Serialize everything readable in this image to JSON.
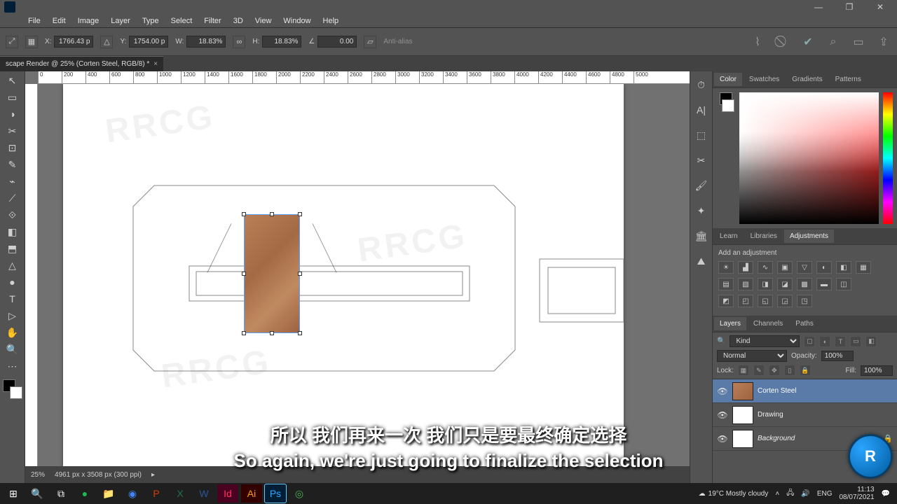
{
  "menu": [
    "File",
    "Edit",
    "Image",
    "Layer",
    "Type",
    "Select",
    "Filter",
    "3D",
    "View",
    "Window",
    "Help"
  ],
  "window_buttons": {
    "min": "—",
    "max": "❐",
    "close": "✕"
  },
  "options": {
    "x_label": "X:",
    "x_val": "1766.43 p",
    "y_label": "Y:",
    "y_val": "1754.00 p",
    "w_label": "W:",
    "w_val": "18.83%",
    "h_label": "H:",
    "h_val": "18.83%",
    "angle_label": "∠",
    "angle_val": "0.00",
    "antialias": "Anti-alias"
  },
  "doc_tab": {
    "title": "scape Render @ 25% (Corten Steel, RGB/8) *"
  },
  "ruler_ticks": [
    "0",
    "200",
    "400",
    "600",
    "800",
    "1000",
    "1200",
    "1400",
    "1600",
    "1800",
    "2000",
    "2200",
    "2400",
    "2600",
    "2800",
    "3000",
    "3200",
    "3400",
    "3600",
    "3800",
    "4000",
    "4200",
    "4400",
    "4600",
    "4800",
    "5000"
  ],
  "status": {
    "zoom": "25%",
    "dims": "4961 px x 3508 px (300 ppi)"
  },
  "right_strip": [
    "⏱",
    "A|",
    "⬚",
    "✂",
    "🖌",
    "✦",
    "🏛",
    "⛰"
  ],
  "tools": [
    "↖",
    "▭",
    "◑",
    "✂",
    "⊡",
    "✎",
    "⌁",
    "⟋",
    "⟐",
    "◧",
    "⬒",
    "△",
    "●",
    "T",
    "▷"
  ],
  "panels": {
    "color_tabs": [
      "Color",
      "Swatches",
      "Gradients",
      "Patterns"
    ],
    "learn_tabs": [
      "Learn",
      "Libraries",
      "Adjustments"
    ],
    "adjust_hint": "Add an adjustment",
    "layers_tabs": [
      "Layers",
      "Channels",
      "Paths"
    ],
    "kind_label": "Kind",
    "blend_mode": "Normal",
    "opacity_label": "Opacity:",
    "opacity_val": "100%",
    "lock_label": "Lock:",
    "fill_label": "Fill:",
    "fill_val": "100%",
    "search_placeholder": "Kind"
  },
  "layers": [
    {
      "name": "Corten Steel",
      "visible": true,
      "selected": true,
      "thumb": "tex",
      "locked": false
    },
    {
      "name": "Drawing",
      "visible": true,
      "selected": false,
      "thumb": "draw",
      "locked": false
    },
    {
      "name": "Background",
      "visible": true,
      "selected": false,
      "thumb": "bg",
      "locked": true,
      "italic": true
    }
  ],
  "subtitles": {
    "zh": "所以 我们再来一次 我们只是要最终确定选择",
    "en": "So again, we're just going to finalize the selection"
  },
  "taskbar": {
    "weather": "19°C  Mostly cloudy",
    "lang": "ENG",
    "time": "11:13",
    "date": "08/07/2021"
  },
  "watermark": "RRCG"
}
